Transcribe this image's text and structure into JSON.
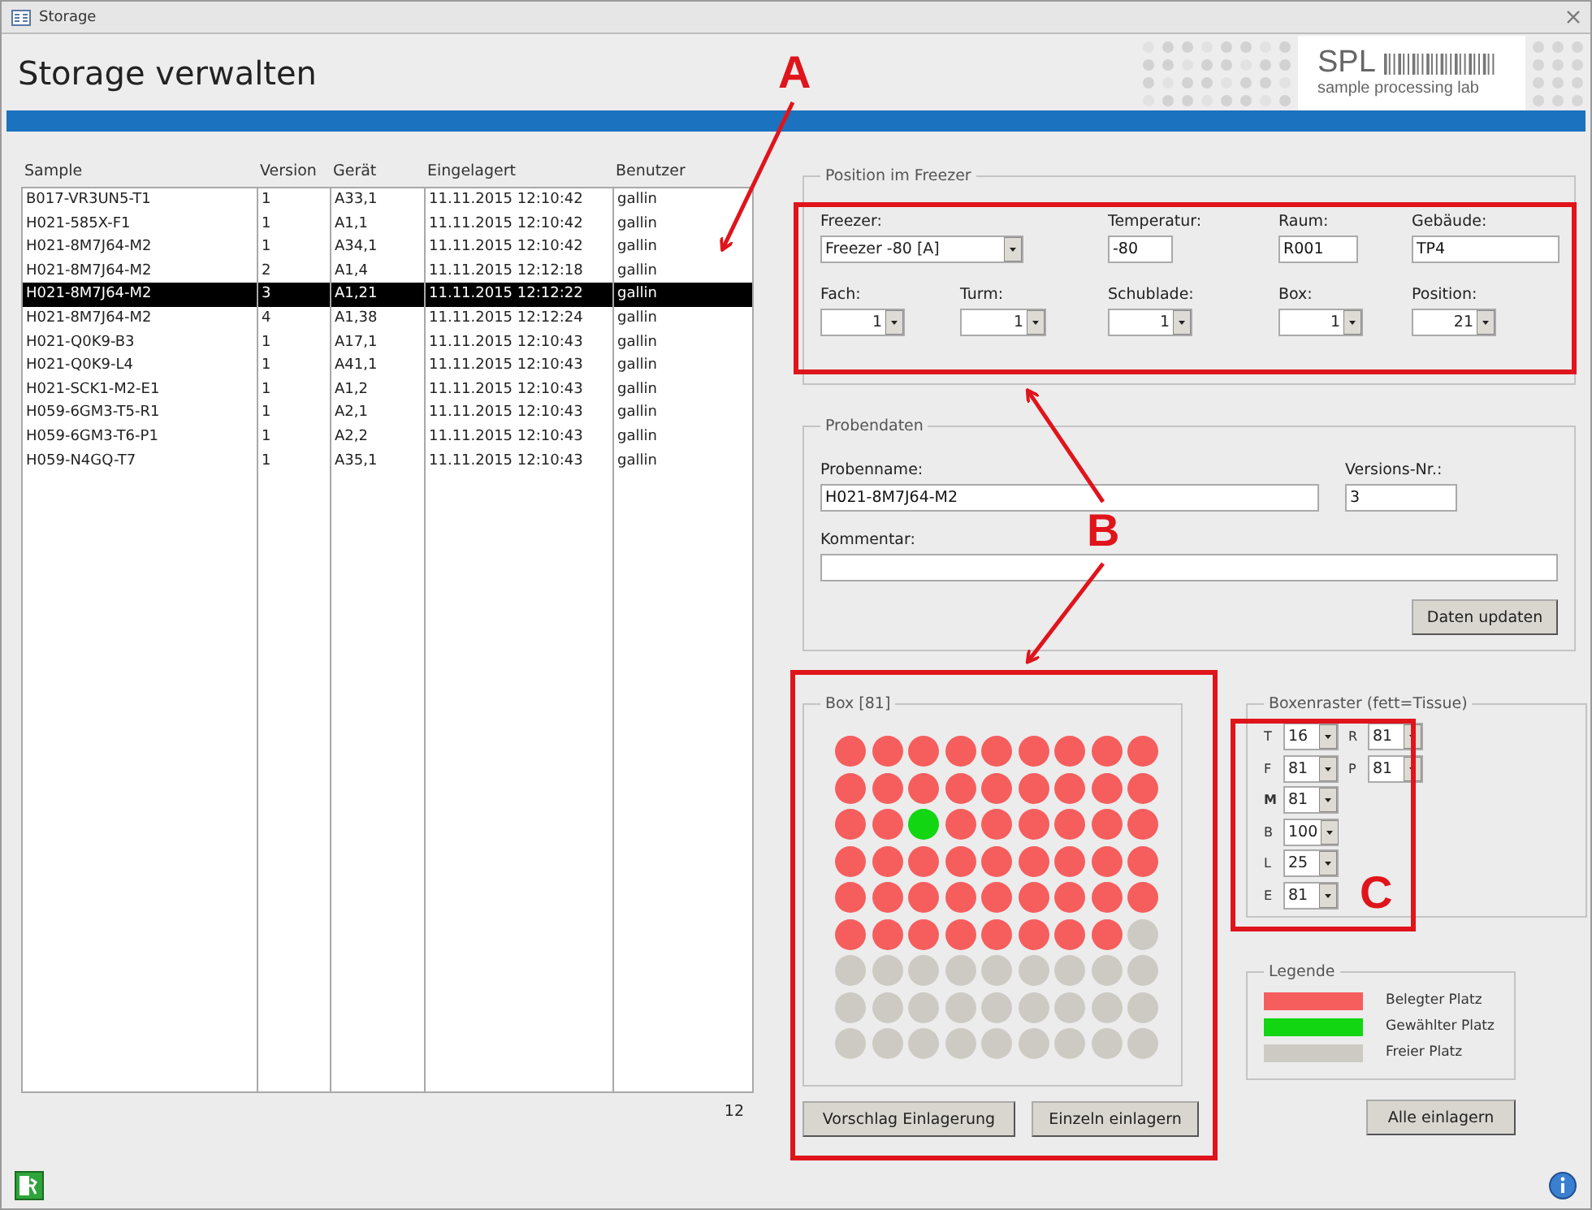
{
  "window": {
    "title": "Storage"
  },
  "header": {
    "title": "Storage verwalten",
    "logo": {
      "mark": "SPL",
      "tagline": "sample processing lab"
    }
  },
  "table": {
    "columns": [
      "Sample",
      "Version",
      "Gerät",
      "Eingelagert",
      "Benutzer"
    ],
    "rows": [
      {
        "cells": [
          "B017-VR3UN5-T1",
          "1",
          "A33,1",
          "11.11.2015 12:10:42",
          "gallin"
        ],
        "selected": false
      },
      {
        "cells": [
          "H021-585X-F1",
          "1",
          "A1,1",
          "11.11.2015 12:10:42",
          "gallin"
        ],
        "selected": false
      },
      {
        "cells": [
          "H021-8M7J64-M2",
          "1",
          "A34,1",
          "11.11.2015 12:10:42",
          "gallin"
        ],
        "selected": false
      },
      {
        "cells": [
          "H021-8M7J64-M2",
          "2",
          "A1,4",
          "11.11.2015 12:12:18",
          "gallin"
        ],
        "selected": false
      },
      {
        "cells": [
          "H021-8M7J64-M2",
          "3",
          "A1,21",
          "11.11.2015 12:12:22",
          "gallin"
        ],
        "selected": true
      },
      {
        "cells": [
          "H021-8M7J64-M2",
          "4",
          "A1,38",
          "11.11.2015 12:12:24",
          "gallin"
        ],
        "selected": false
      },
      {
        "cells": [
          "H021-Q0K9-B3",
          "1",
          "A17,1",
          "11.11.2015 12:10:43",
          "gallin"
        ],
        "selected": false
      },
      {
        "cells": [
          "H021-Q0K9-L4",
          "1",
          "A41,1",
          "11.11.2015 12:10:43",
          "gallin"
        ],
        "selected": false
      },
      {
        "cells": [
          "H021-SCK1-M2-E1",
          "1",
          "A1,2",
          "11.11.2015 12:10:43",
          "gallin"
        ],
        "selected": false
      },
      {
        "cells": [
          "H059-6GM3-T5-R1",
          "1",
          "A2,1",
          "11.11.2015 12:10:43",
          "gallin"
        ],
        "selected": false
      },
      {
        "cells": [
          "H059-6GM3-T6-P1",
          "1",
          "A2,2",
          "11.11.2015 12:10:43",
          "gallin"
        ],
        "selected": false
      },
      {
        "cells": [
          "H059-N4GQ-T7",
          "1",
          "A35,1",
          "11.11.2015 12:10:43",
          "gallin"
        ],
        "selected": false
      }
    ],
    "count": "12"
  },
  "position": {
    "title": "Position im Freezer",
    "row_1": [
      {
        "label": "Freezer:",
        "value": "Freezer -80 [A]",
        "kind": "combo"
      },
      {
        "label": "Temperatur:",
        "value": "-80",
        "kind": "text"
      },
      {
        "label": "Raum:",
        "value": "R001",
        "kind": "text"
      },
      {
        "label": "Gebäude:",
        "value": "TP4",
        "kind": "text"
      }
    ],
    "row_2": [
      {
        "label": "Fach:",
        "value": "1",
        "kind": "combo"
      },
      {
        "label": "Turm:",
        "value": "1",
        "kind": "combo"
      },
      {
        "label": "Schublade:",
        "value": "1",
        "kind": "combo"
      },
      {
        "label": "Box:",
        "value": "1",
        "kind": "combo"
      },
      {
        "label": "Position:",
        "value": "21",
        "kind": "combo"
      }
    ]
  },
  "sample_data": {
    "title": "Probendaten",
    "name_label": "Probenname:",
    "name_value": "H021-8M7J64-M2",
    "version_label": "Versions-Nr.:",
    "version_value": "3",
    "comment_label": "Kommentar:",
    "button": "Daten updaten"
  },
  "box": {
    "title": "Box [81]",
    "slots": [
      {
        "color": "#f65e5e"
      },
      {
        "color": "#f65e5e"
      },
      {
        "color": "#f65e5e"
      },
      {
        "color": "#f65e5e"
      },
      {
        "color": "#f65e5e"
      },
      {
        "color": "#f65e5e"
      },
      {
        "color": "#f65e5e"
      },
      {
        "color": "#f65e5e"
      },
      {
        "color": "#f65e5e"
      },
      {
        "color": "#f65e5e"
      },
      {
        "color": "#f65e5e"
      },
      {
        "color": "#f65e5e"
      },
      {
        "color": "#f65e5e"
      },
      {
        "color": "#f65e5e"
      },
      {
        "color": "#f65e5e"
      },
      {
        "color": "#f65e5e"
      },
      {
        "color": "#f65e5e"
      },
      {
        "color": "#f65e5e"
      },
      {
        "color": "#f65e5e"
      },
      {
        "color": "#f65e5e"
      },
      {
        "color": "#12d612"
      },
      {
        "color": "#f65e5e"
      },
      {
        "color": "#f65e5e"
      },
      {
        "color": "#f65e5e"
      },
      {
        "color": "#f65e5e"
      },
      {
        "color": "#f65e5e"
      },
      {
        "color": "#f65e5e"
      },
      {
        "color": "#f65e5e"
      },
      {
        "color": "#f65e5e"
      },
      {
        "color": "#f65e5e"
      },
      {
        "color": "#f65e5e"
      },
      {
        "color": "#f65e5e"
      },
      {
        "color": "#f65e5e"
      },
      {
        "color": "#f65e5e"
      },
      {
        "color": "#f65e5e"
      },
      {
        "color": "#f65e5e"
      },
      {
        "color": "#f65e5e"
      },
      {
        "color": "#f65e5e"
      },
      {
        "color": "#f65e5e"
      },
      {
        "color": "#f65e5e"
      },
      {
        "color": "#f65e5e"
      },
      {
        "color": "#f65e5e"
      },
      {
        "color": "#f65e5e"
      },
      {
        "color": "#f65e5e"
      },
      {
        "color": "#f65e5e"
      },
      {
        "color": "#f65e5e"
      },
      {
        "color": "#f65e5e"
      },
      {
        "color": "#f65e5e"
      },
      {
        "color": "#f65e5e"
      },
      {
        "color": "#f65e5e"
      },
      {
        "color": "#f65e5e"
      },
      {
        "color": "#f65e5e"
      },
      {
        "color": "#f65e5e"
      },
      {
        "color": "#cdcac4"
      },
      {
        "color": "#cdcac4"
      },
      {
        "color": "#cdcac4"
      },
      {
        "color": "#cdcac4"
      },
      {
        "color": "#cdcac4"
      },
      {
        "color": "#cdcac4"
      },
      {
        "color": "#cdcac4"
      },
      {
        "color": "#cdcac4"
      },
      {
        "color": "#cdcac4"
      },
      {
        "color": "#cdcac4"
      },
      {
        "color": "#cdcac4"
      },
      {
        "color": "#cdcac4"
      },
      {
        "color": "#cdcac4"
      },
      {
        "color": "#cdcac4"
      },
      {
        "color": "#cdcac4"
      },
      {
        "color": "#cdcac4"
      },
      {
        "color": "#cdcac4"
      },
      {
        "color": "#cdcac4"
      },
      {
        "color": "#cdcac4"
      },
      {
        "color": "#cdcac4"
      },
      {
        "color": "#cdcac4"
      },
      {
        "color": "#cdcac4"
      },
      {
        "color": "#cdcac4"
      },
      {
        "color": "#cdcac4"
      },
      {
        "color": "#cdcac4"
      },
      {
        "color": "#cdcac4"
      },
      {
        "color": "#cdcac4"
      },
      {
        "color": "#cdcac4"
      }
    ],
    "buttons": [
      "Vorschlag Einlagerung",
      "Einzeln einlagern"
    ]
  },
  "box_grid": {
    "title": "Boxenraster (fett=Tissue)",
    "column_1": [
      {
        "label": "T",
        "value": "16",
        "bold": false
      },
      {
        "label": "F",
        "value": "81",
        "bold": false
      },
      {
        "label": "M",
        "value": "81",
        "bold": true
      },
      {
        "label": "B",
        "value": "100",
        "bold": false
      },
      {
        "label": "L",
        "value": "25",
        "bold": false
      },
      {
        "label": "E",
        "value": "81",
        "bold": false
      }
    ],
    "column_2": [
      {
        "label": "R",
        "value": "81",
        "bold": false
      },
      {
        "label": "P",
        "value": "81",
        "bold": false
      }
    ]
  },
  "legend": {
    "title": "Legende",
    "items": [
      {
        "label": "Belegter Platz",
        "color": "#f65e5e"
      },
      {
        "label": "Gewählter Platz",
        "color": "#12d612"
      },
      {
        "label": "Freier Platz",
        "color": "#cdcac4"
      }
    ]
  },
  "store_all_button": "Alle einlagern",
  "annotations": [
    {
      "label": "A"
    },
    {
      "label": "B"
    },
    {
      "label": "C"
    }
  ]
}
